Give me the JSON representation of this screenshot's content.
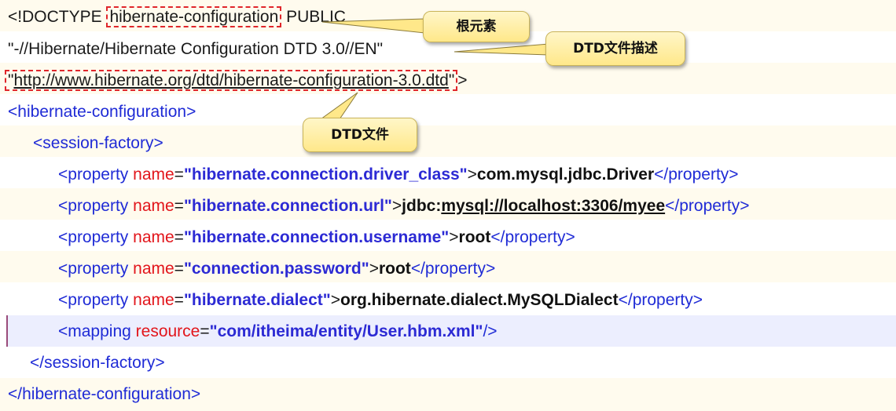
{
  "lines": {
    "l1": {
      "lt": "<!DOCTYPE ",
      "root": "hibernate-configuration",
      "public": " PUBLIC"
    },
    "l2": {
      "text": "\"-//Hibernate/Hibernate Configuration DTD 3.0//EN\""
    },
    "l3": {
      "q1": "\"",
      "url": "http://www.hibernate.org/dtd/hibernate-configuration-3.0.dtd",
      "q2": "\"",
      "gt": ">"
    },
    "l4": {
      "text": "<hibernate-configuration>"
    },
    "l5": {
      "text": "<session-factory>"
    },
    "properties": [
      {
        "open": "<property ",
        "attr": "name",
        "eq": "=",
        "val": "\"hibernate.connection.driver_class\"",
        "gt": ">",
        "content": "com.mysql.jdbc.Driver",
        "close": "</property>"
      },
      {
        "open": "<property ",
        "attr": "name",
        "eq": "=",
        "val": "\"hibernate.connection.url\"",
        "gt": ">",
        "content_a": "jdbc:",
        "content_b": "mysql://localhost:3306/myee",
        "close": "</property>"
      },
      {
        "open": "<property ",
        "attr": "name",
        "eq": "=",
        "val": "\"hibernate.connection.username\"",
        "gt": ">",
        "content": "root",
        "close": "</property>"
      },
      {
        "open": "<property ",
        "attr": "name",
        "eq": "=",
        "val": "\"connection.password\"",
        "gt": ">",
        "content": "root",
        "close": "</property>"
      },
      {
        "open": "<property ",
        "attr": "name",
        "eq": "=",
        "val": "\"hibernate.dialect\"",
        "gt": ">",
        "content": "org.hibernate.dialect.MySQLDialect",
        "close": "</property>"
      }
    ],
    "mapping": {
      "open": "<mapping ",
      "attr": "resource",
      "eq": "=",
      "val": "\"com/itheima/entity/User.hbm.xml\"",
      "close": "/>"
    },
    "l12": {
      "text": "</session-factory>"
    },
    "l13": {
      "text": "</hibernate-configuration>"
    }
  },
  "callouts": {
    "root_element": "根元素",
    "dtd_description": "DTD文件描述",
    "dtd_file": "DTD文件"
  },
  "colors": {
    "tag": "#1f2bd6",
    "attr": "#e2151b",
    "value": "#2c2ad4",
    "highlight": "#eceefe",
    "callout": "#ffe88a",
    "dashed_border": "#e0262b"
  }
}
